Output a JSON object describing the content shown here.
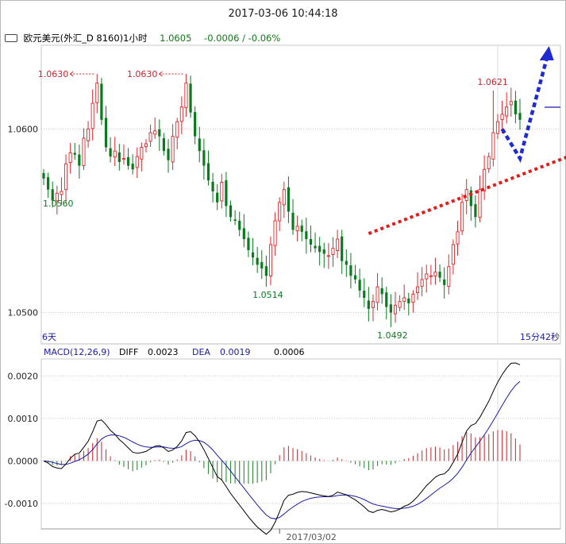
{
  "title": "2017-03-06 10:44:18",
  "header": {
    "instrument": "欧元美元(外汇_D 8160)1小时",
    "price": "1.0605",
    "change": "-0.0006 / -0.06%"
  },
  "chart_data": [
    {
      "type": "candlestick",
      "ylim": [
        1.0492,
        1.064
      ],
      "yticks": [
        "1.0600",
        "1.0500"
      ],
      "ytick_values": [
        1.06,
        1.05
      ],
      "grid": true,
      "left_labels": {
        "top": "1.0560",
        "bottom": "6天"
      },
      "right_label": "15分42秒",
      "annotations": [
        {
          "text": "1.0630",
          "index": 12,
          "value": 1.063,
          "kind": "high"
        },
        {
          "text": "1.0630",
          "index": 32,
          "value": 1.063,
          "kind": "high"
        },
        {
          "text": "1.0514",
          "index": 50,
          "value": 1.0514,
          "kind": "low"
        },
        {
          "text": "1.0492",
          "index": 78,
          "value": 1.0492,
          "kind": "low"
        },
        {
          "text": "1.0621",
          "index": 101,
          "value": 1.0621,
          "kind": "high"
        }
      ],
      "closes": [
        1.0573,
        1.0567,
        1.0561,
        1.0565,
        1.0566,
        1.0581,
        1.0587,
        1.0586,
        1.058,
        1.0595,
        1.06,
        1.0614,
        1.0625,
        1.0605,
        1.059,
        1.0585,
        1.0588,
        1.0582,
        1.0584,
        1.058,
        1.0578,
        1.0585,
        1.059,
        1.0592,
        1.0598,
        1.0599,
        1.0596,
        1.0588,
        1.0583,
        1.0596,
        1.0604,
        1.0612,
        1.0625,
        1.0609,
        1.0596,
        1.0588,
        1.058,
        1.0572,
        1.0566,
        1.056,
        1.0571,
        1.0558,
        1.0552,
        1.055,
        1.0545,
        1.054,
        1.0534,
        1.053,
        1.0526,
        1.0524,
        1.052,
        1.0537,
        1.055,
        1.056,
        1.0567,
        1.0555,
        1.0545,
        1.0547,
        1.0544,
        1.054,
        1.0537,
        1.0535,
        1.0533,
        1.0532,
        1.0531,
        1.0535,
        1.054,
        1.0528,
        1.0526,
        1.052,
        1.0518,
        1.0512,
        1.0508,
        1.0502,
        1.0506,
        1.0514,
        1.051,
        1.0503,
        1.05,
        1.0504,
        1.0506,
        1.0508,
        1.0505,
        1.051,
        1.0514,
        1.0518,
        1.0521,
        1.052,
        1.0522,
        1.0519,
        1.0515,
        1.0525,
        1.0537,
        1.0544,
        1.056,
        1.0567,
        1.0558,
        1.0552,
        1.0567,
        1.0578,
        1.0585,
        1.0598,
        1.0604,
        1.0608,
        1.0612,
        1.0615,
        1.0608,
        1.0605
      ],
      "up_color": "#e0262a",
      "down_color": "#0a7a1e",
      "overlay_lines": [
        {
          "style": "red-dotted",
          "from": [
            73,
            1.0543
          ],
          "to": [
            120,
            1.0587
          ]
        },
        {
          "style": "blue-dashed-arrow",
          "from": [
            103,
            1.06
          ],
          "via": [
            107,
            1.0584
          ],
          "to": [
            113,
            1.064
          ]
        }
      ]
    },
    {
      "type": "macd",
      "title": "MACD(12,26,9)",
      "legend": [
        {
          "name": "DIFF",
          "value": "0.0023",
          "color": "#000000"
        },
        {
          "name": "DEA",
          "value": "0.0019",
          "color": "#1a1aa8"
        },
        {
          "name": "",
          "value": "0.0006",
          "color": "#000000"
        }
      ],
      "ylim": [
        -0.0016,
        0.0024
      ],
      "yticks": [
        "0.0020",
        "0.0010",
        "0.0000",
        "-0.0010"
      ],
      "ytick_values": [
        0.002,
        0.001,
        0.0,
        -0.001
      ],
      "xlabel": "2017/03/02",
      "x_marker_index": 53,
      "pos_color": "#d0343a",
      "neg_color": "#2e8b3a"
    }
  ]
}
